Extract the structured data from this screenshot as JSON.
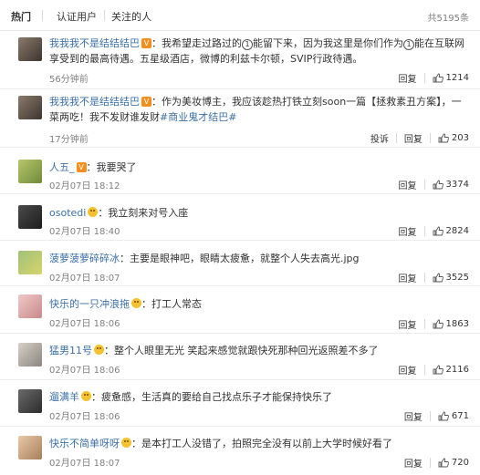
{
  "tabs": {
    "hot": "热门",
    "verified": "认证用户",
    "following": "关注的人"
  },
  "total": "共5195条",
  "actions": {
    "reply": "回复",
    "report": "投诉"
  },
  "comments": [
    {
      "user": "我我我不是结结结巴",
      "badge": "V",
      "text_a": "：我希望走过路过的",
      "circle1": "1",
      "text_b": "能留下来，因为我这里是你们作为",
      "circle2": "1",
      "text_c": "能在互联网享受到的最高待遇。五星级酒店，微博的利兹卡尔顿，SVIP行政待遇。",
      "time": "56分钟前",
      "likes": "1214"
    },
    {
      "user": "我我我不是结结结巴",
      "badge": "V",
      "text": "：作为美妆博主，我应该趁热打铁立刻soon一篇【拯救素丑方案】，一菜两吃！我不发财谁发财",
      "tag": "#商业鬼才结巴#",
      "time": "17分钟前",
      "likes": "203"
    },
    {
      "user": "人五_",
      "badge": "V",
      "text": "：我要哭了",
      "time": "02月07日 18:12",
      "likes": "3374"
    },
    {
      "user": "osotedi",
      "text": "：我立刻来对号入座",
      "time": "02月07日 18:40",
      "likes": "2824"
    },
    {
      "user": "菠萝菠萝碎碎冰",
      "text": "：主要是眼神吧，眼睛太疲惫，就整个人失去高光.jpg",
      "time": "02月07日 18:07",
      "likes": "3525"
    },
    {
      "user": "快乐的一只冲浪拖",
      "text": "：打工人常态",
      "time": "02月07日 18:06",
      "likes": "1863"
    },
    {
      "user": "猛男11号",
      "text": "：整个人眼里无光 笑起来感觉就跟快死那种回光返照差不多了",
      "time": "02月07日 18:06",
      "likes": "2116"
    },
    {
      "user": "遛满羊",
      "text": "：疲惫感，生活真的要给自己找点乐子才能保持快乐了",
      "time": "02月07日 18:06",
      "likes": "671"
    },
    {
      "user": "快乐不简单呀呀",
      "text": "：是本打工人没错了，拍照完全没有以前上大学时候好看了",
      "time": "02月07日 18:07",
      "likes": "720"
    }
  ],
  "colors": {
    "link": "#3b6fa6",
    "badge": "#f28f1f",
    "emoji": "#f4c22e"
  }
}
